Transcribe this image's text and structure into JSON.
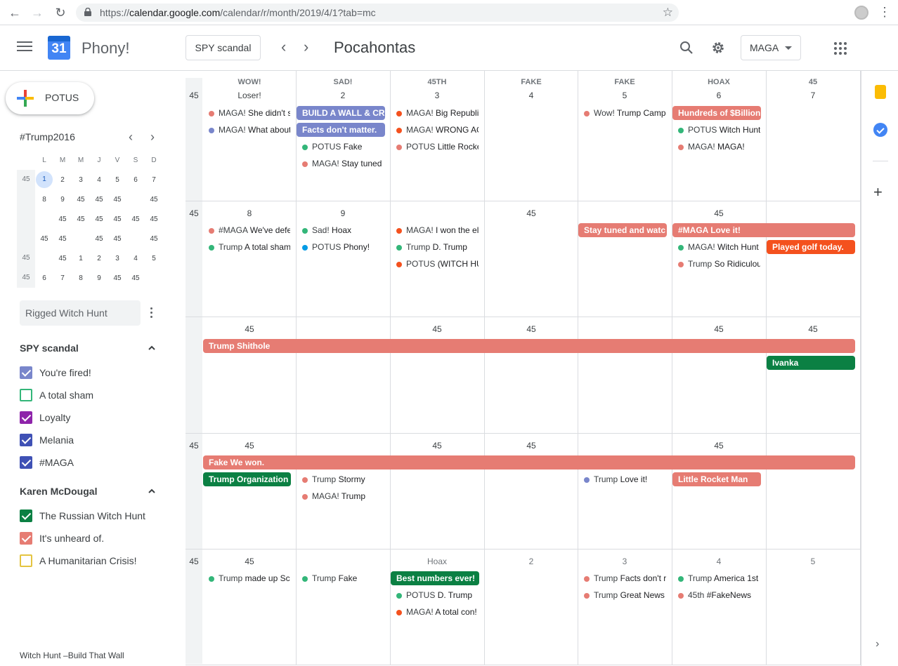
{
  "browser": {
    "url_prefix": "https://",
    "url_host": "calendar.google.com",
    "url_path": "/calendar/r/month/2019/4/1?tab=mc"
  },
  "header": {
    "app_name": "Phony!",
    "logo_day": "31",
    "today_label": "SPY scandal",
    "title": "Pocahontas",
    "view_label": "MAGA"
  },
  "sidebar": {
    "create_label": "POTUS",
    "mini_title": "#Trump2016",
    "mini_days": [
      "L",
      "M",
      "M",
      "J",
      "V",
      "S",
      "D"
    ],
    "mini_rows": [
      {
        "wk": "45",
        "d": [
          "1",
          "2",
          "3",
          "4",
          "5",
          "6",
          "7"
        ]
      },
      {
        "wk": "",
        "d": [
          "8",
          "9",
          "45",
          "45",
          "45",
          "",
          "45"
        ]
      },
      {
        "wk": "",
        "d": [
          "",
          "45",
          "45",
          "45",
          "45",
          "45",
          "45"
        ]
      },
      {
        "wk": "",
        "d": [
          "45",
          "45",
          "",
          "45",
          "45",
          "",
          "45"
        ]
      },
      {
        "wk": "45",
        "d": [
          "",
          "45",
          "1",
          "2",
          "3",
          "4",
          "5"
        ]
      },
      {
        "wk": "45",
        "d": [
          "6",
          "7",
          "8",
          "9",
          "45",
          "45",
          ""
        ]
      }
    ],
    "search_placeholder": "Rigged Witch Hunt",
    "my_section": "SPY scandal",
    "my_calendars": [
      {
        "label": "You're fired!",
        "color": "#7986cb",
        "checked": true
      },
      {
        "label": "A total sham",
        "color": "#33b679",
        "checked": false
      },
      {
        "label": "Loyalty",
        "color": "#8e24aa",
        "checked": true
      },
      {
        "label": "Melania",
        "color": "#3f51b5",
        "checked": true
      },
      {
        "label": "#MAGA",
        "color": "#3f51b5",
        "checked": true
      }
    ],
    "other_section": "Karen McDougal",
    "other_calendars": [
      {
        "label": "The Russian Witch Hunt",
        "color": "#0b8043",
        "checked": true
      },
      {
        "label": "It's unheard of.",
        "color": "#e67c73",
        "checked": true
      },
      {
        "label": "A Humanitarian Crisis!",
        "color": "#e4c441",
        "checked": false
      }
    ],
    "footer": "Witch Hunt –Build That Wall"
  },
  "grid": {
    "day_names": [
      "WOW!",
      "SAD!",
      "45TH",
      "FAKE",
      "FAKE",
      "HOAX",
      "45"
    ],
    "weeks": [
      {
        "wk": "45",
        "days": [
          {
            "n": "Loser!"
          },
          {
            "n": "2"
          },
          {
            "n": "3"
          },
          {
            "n": "4"
          },
          {
            "n": "5"
          },
          {
            "n": "6"
          },
          {
            "n": "7"
          }
        ],
        "dots": [
          {
            "col": 0,
            "row": 0,
            "who": "MAGA!",
            "what": "She didn't s",
            "color": "#e67c73"
          },
          {
            "col": 0,
            "row": 1,
            "who": "MAGA!",
            "what": "What about",
            "color": "#7986cb"
          },
          {
            "col": 1,
            "row": 2,
            "who": "POTUS",
            "what": "Fake",
            "color": "#33b679"
          },
          {
            "col": 1,
            "row": 3,
            "who": "MAGA!",
            "what": "Stay tuned",
            "color": "#e67c73"
          },
          {
            "col": 2,
            "row": 0,
            "who": "MAGA!",
            "what": "Big Republi",
            "color": "#f4511e"
          },
          {
            "col": 2,
            "row": 1,
            "who": "MAGA!",
            "what": "WRONG AG",
            "color": "#f4511e"
          },
          {
            "col": 2,
            "row": 2,
            "who": "POTUS",
            "what": "Little Rocke",
            "color": "#e67c73"
          },
          {
            "col": 4,
            "row": 0,
            "who": "Wow!",
            "what": "Trump Camp",
            "color": "#e67c73"
          },
          {
            "col": 5,
            "row": 1,
            "who": "POTUS",
            "what": "Witch Hunt",
            "color": "#33b679"
          },
          {
            "col": 5,
            "row": 2,
            "who": "MAGA!",
            "what": "MAGA!",
            "color": "#e67c73"
          }
        ],
        "chips": [
          {
            "col": 1,
            "span": 1,
            "row": 0,
            "label": "BUILD A WALL & CR",
            "color": "#7986cb"
          },
          {
            "col": 1,
            "span": 1,
            "row": 1,
            "label": "Facts don't matter.",
            "color": "#7986cb"
          },
          {
            "col": 5,
            "span": 1,
            "row": 0,
            "label": "Hundreds of $Billion",
            "color": "#e67c73"
          }
        ]
      },
      {
        "wk": "45",
        "days": [
          {
            "n": "8"
          },
          {
            "n": "9"
          },
          {
            "n": ""
          },
          {
            "n": "45"
          },
          {
            "n": ""
          },
          {
            "n": "45"
          },
          {
            "n": ""
          }
        ],
        "dots": [
          {
            "col": 0,
            "row": 0,
            "who": "#MAGA",
            "what": "We've defe",
            "color": "#e67c73"
          },
          {
            "col": 0,
            "row": 1,
            "who": "Trump",
            "what": "A total sham",
            "color": "#33b679"
          },
          {
            "col": 1,
            "row": 0,
            "who": "Sad!",
            "what": "Hoax",
            "color": "#33b679"
          },
          {
            "col": 1,
            "row": 1,
            "who": "POTUS",
            "what": "Phony!",
            "color": "#039be5"
          },
          {
            "col": 2,
            "row": 0,
            "who": "MAGA!",
            "what": "I won the el",
            "color": "#f4511e"
          },
          {
            "col": 2,
            "row": 1,
            "who": "Trump",
            "what": "D. Trump",
            "color": "#33b679"
          },
          {
            "col": 2,
            "row": 2,
            "who": "POTUS",
            "what": "(WITCH HU",
            "color": "#f4511e"
          },
          {
            "col": 5,
            "row": 1,
            "who": "MAGA!",
            "what": "Witch Hunt",
            "color": "#33b679"
          },
          {
            "col": 5,
            "row": 2,
            "who": "Trump",
            "what": "So Ridiculou",
            "color": "#e67c73"
          }
        ],
        "chips": [
          {
            "col": 4,
            "span": 1,
            "row": 0,
            "label": "Stay tuned and watc",
            "color": "#e67c73"
          },
          {
            "col": 5,
            "span": 2,
            "row": 0,
            "label": "#MAGA Love it!",
            "color": "#e67c73"
          },
          {
            "col": 6,
            "span": 1,
            "row": 1,
            "label": "Played golf today.",
            "color": "#f4511e"
          }
        ]
      },
      {
        "wk": "",
        "days": [
          {
            "n": "45"
          },
          {
            "n": ""
          },
          {
            "n": "45"
          },
          {
            "n": "45"
          },
          {
            "n": ""
          },
          {
            "n": "45"
          },
          {
            "n": "45"
          }
        ],
        "dots": [],
        "chips": [
          {
            "col": 0,
            "span": 7,
            "row": 0,
            "label": "Trump Shithole",
            "color": "#e67c73"
          },
          {
            "col": 6,
            "span": 1,
            "row": 1,
            "label": "Ivanka",
            "color": "#0b8043"
          }
        ]
      },
      {
        "wk": "45",
        "days": [
          {
            "n": "45"
          },
          {
            "n": ""
          },
          {
            "n": "45"
          },
          {
            "n": "45"
          },
          {
            "n": ""
          },
          {
            "n": "45"
          },
          {
            "n": ""
          }
        ],
        "dots": [
          {
            "col": 1,
            "row": 1,
            "who": "Trump",
            "what": "Stormy",
            "color": "#e67c73"
          },
          {
            "col": 1,
            "row": 2,
            "who": "MAGA!",
            "what": "Trump",
            "color": "#e67c73"
          },
          {
            "col": 4,
            "row": 1,
            "who": "Trump",
            "what": "Love it!",
            "color": "#7986cb"
          }
        ],
        "chips": [
          {
            "col": 0,
            "span": 7,
            "row": 0,
            "label": "Fake We won.",
            "color": "#e67c73"
          },
          {
            "col": 0,
            "span": 1,
            "row": 1,
            "label": "Trump Organization",
            "color": "#0b8043"
          },
          {
            "col": 5,
            "span": 1,
            "row": 1,
            "label": "Little Rocket Man",
            "color": "#e67c73"
          }
        ]
      },
      {
        "wk": "45",
        "days": [
          {
            "n": "45"
          },
          {
            "n": ""
          },
          {
            "n": "Hoax",
            "muted": true
          },
          {
            "n": "2",
            "muted": true
          },
          {
            "n": "3",
            "muted": true
          },
          {
            "n": "4",
            "muted": true
          },
          {
            "n": "5",
            "muted": true
          }
        ],
        "dots": [
          {
            "col": 0,
            "row": 0,
            "who": "Trump",
            "what": "made up Sc",
            "color": "#33b679"
          },
          {
            "col": 1,
            "row": 0,
            "who": "Trump",
            "what": "Fake",
            "color": "#33b679"
          },
          {
            "col": 2,
            "row": 1,
            "who": "POTUS",
            "what": "D. Trump",
            "color": "#33b679"
          },
          {
            "col": 2,
            "row": 2,
            "who": "MAGA!",
            "what": "A total con!",
            "color": "#f4511e"
          },
          {
            "col": 4,
            "row": 0,
            "who": "Trump",
            "what": "Facts don't r",
            "color": "#e67c73"
          },
          {
            "col": 4,
            "row": 1,
            "who": "Trump",
            "what": "Great News",
            "color": "#e67c73"
          },
          {
            "col": 5,
            "row": 0,
            "who": "Trump",
            "what": "America 1st",
            "color": "#33b679"
          },
          {
            "col": 5,
            "row": 1,
            "who": "45th",
            "what": "#FakeNews",
            "color": "#e67c73"
          }
        ],
        "chips": [
          {
            "col": 2,
            "span": 1,
            "row": 0,
            "label": "Best numbers ever!",
            "color": "#0b8043"
          }
        ]
      }
    ]
  }
}
